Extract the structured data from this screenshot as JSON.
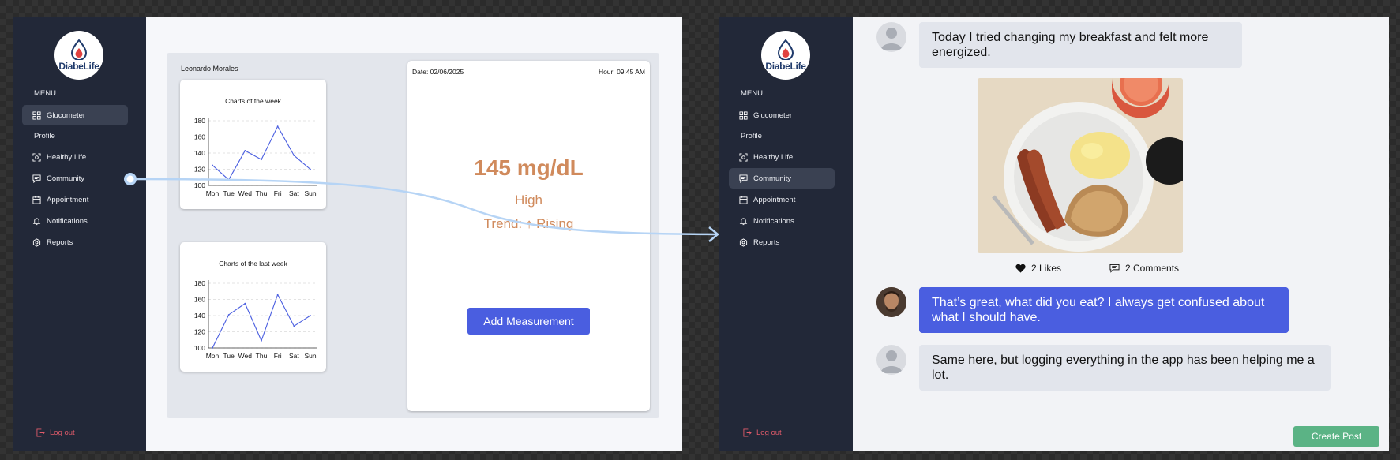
{
  "app": {
    "logo_text": "DiabeLife"
  },
  "sidebar": {
    "menu_heading": "MENU",
    "profile_heading": "Profile",
    "items": [
      {
        "label": "Glucometer",
        "icon": "dashboard-icon"
      },
      {
        "label": "Healthy Life",
        "icon": "scan-face-icon"
      },
      {
        "label": "Community",
        "icon": "chat-icon"
      },
      {
        "label": "Appointment",
        "icon": "calendar-icon"
      },
      {
        "label": "Notifications",
        "icon": "bell-icon"
      },
      {
        "label": "Reports",
        "icon": "hexagon-icon"
      }
    ],
    "logout_label": "Log out"
  },
  "glucometer": {
    "user_name": "Leonardo Morales",
    "date": "Date: 02/06/2025",
    "hour": "Hour: 09:45 AM",
    "value": "145 mg/dL",
    "status": "High",
    "trend": "Trend: ↑ Rising",
    "add_button": "Add Measurement"
  },
  "chart_data": [
    {
      "type": "line",
      "title": "Charts of the week",
      "categories": [
        "Mon",
        "Tue",
        "Wed",
        "Thu",
        "Fri",
        "Sat",
        "Sun"
      ],
      "values": [
        125,
        107,
        143,
        132,
        173,
        137,
        120
      ],
      "yticks": [
        100,
        120,
        140,
        160,
        180
      ],
      "ylim": [
        100,
        180
      ],
      "color": "#4a5ee0"
    },
    {
      "type": "line",
      "title": "Charts of the last week",
      "categories": [
        "Mon",
        "Tue",
        "Wed",
        "Thu",
        "Fri",
        "Sat",
        "Sun"
      ],
      "values": [
        100,
        141,
        155,
        109,
        166,
        127,
        140
      ],
      "yticks": [
        100,
        120,
        140,
        160,
        180
      ],
      "ylim": [
        100,
        180
      ],
      "color": "#4a5ee0"
    }
  ],
  "community": {
    "posts": [
      {
        "text": "Today I tried changing my breakfast and felt more energized."
      },
      {
        "text": "That’s great, what did you eat? I always get confused about what I should have."
      },
      {
        "text": "Same here, but logging everything in the app has been helping me a lot."
      }
    ],
    "likes": "2 Likes",
    "comments": "2 Comments",
    "create_button": "Create Post"
  },
  "colors": {
    "sidebar": "#222838",
    "accent": "#4a5ee0",
    "reading": "#d08a5c",
    "create": "#5bb385",
    "logout": "#e05b6a"
  }
}
